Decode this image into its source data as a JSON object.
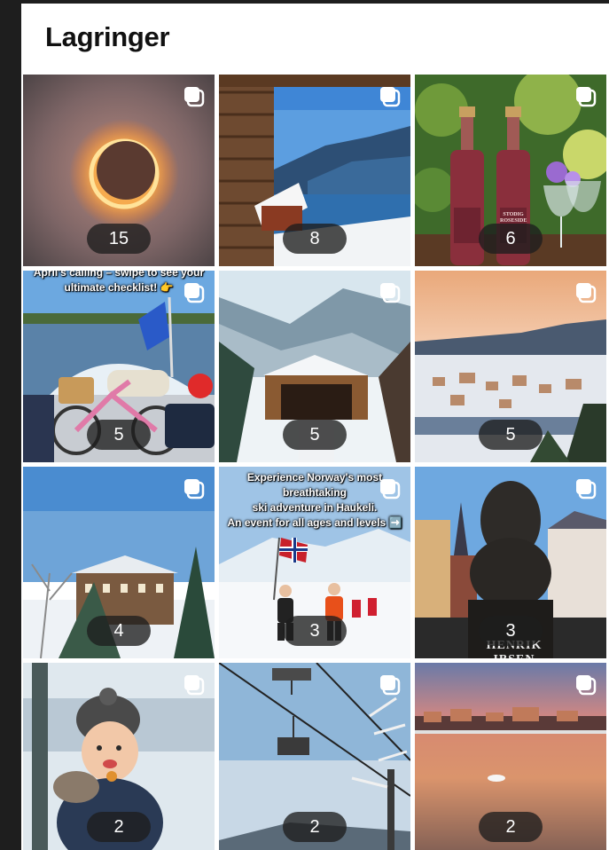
{
  "header": {
    "title": "Lagringer"
  },
  "collections": [
    {
      "count": "15"
    },
    {
      "count": "8"
    },
    {
      "count": "6",
      "bottle_label": [
        "STODIG",
        "ROSESIDE"
      ]
    },
    {
      "count": "5",
      "caption": [
        "April's calling – swipe to see your",
        "ultimate checklist! 👉"
      ]
    },
    {
      "count": "5"
    },
    {
      "count": "5"
    },
    {
      "count": "4"
    },
    {
      "count": "3",
      "caption": [
        "Experience Norway's most breathtaking",
        "ski adventure in Haukeli.",
        "An event for all ages and levels ➡️"
      ]
    },
    {
      "count": "3",
      "plaque": "HENRIK IBSEN"
    },
    {
      "count": "2"
    },
    {
      "count": "2"
    },
    {
      "count": "2"
    }
  ],
  "icons": {
    "multi": "multiple-items-icon"
  }
}
